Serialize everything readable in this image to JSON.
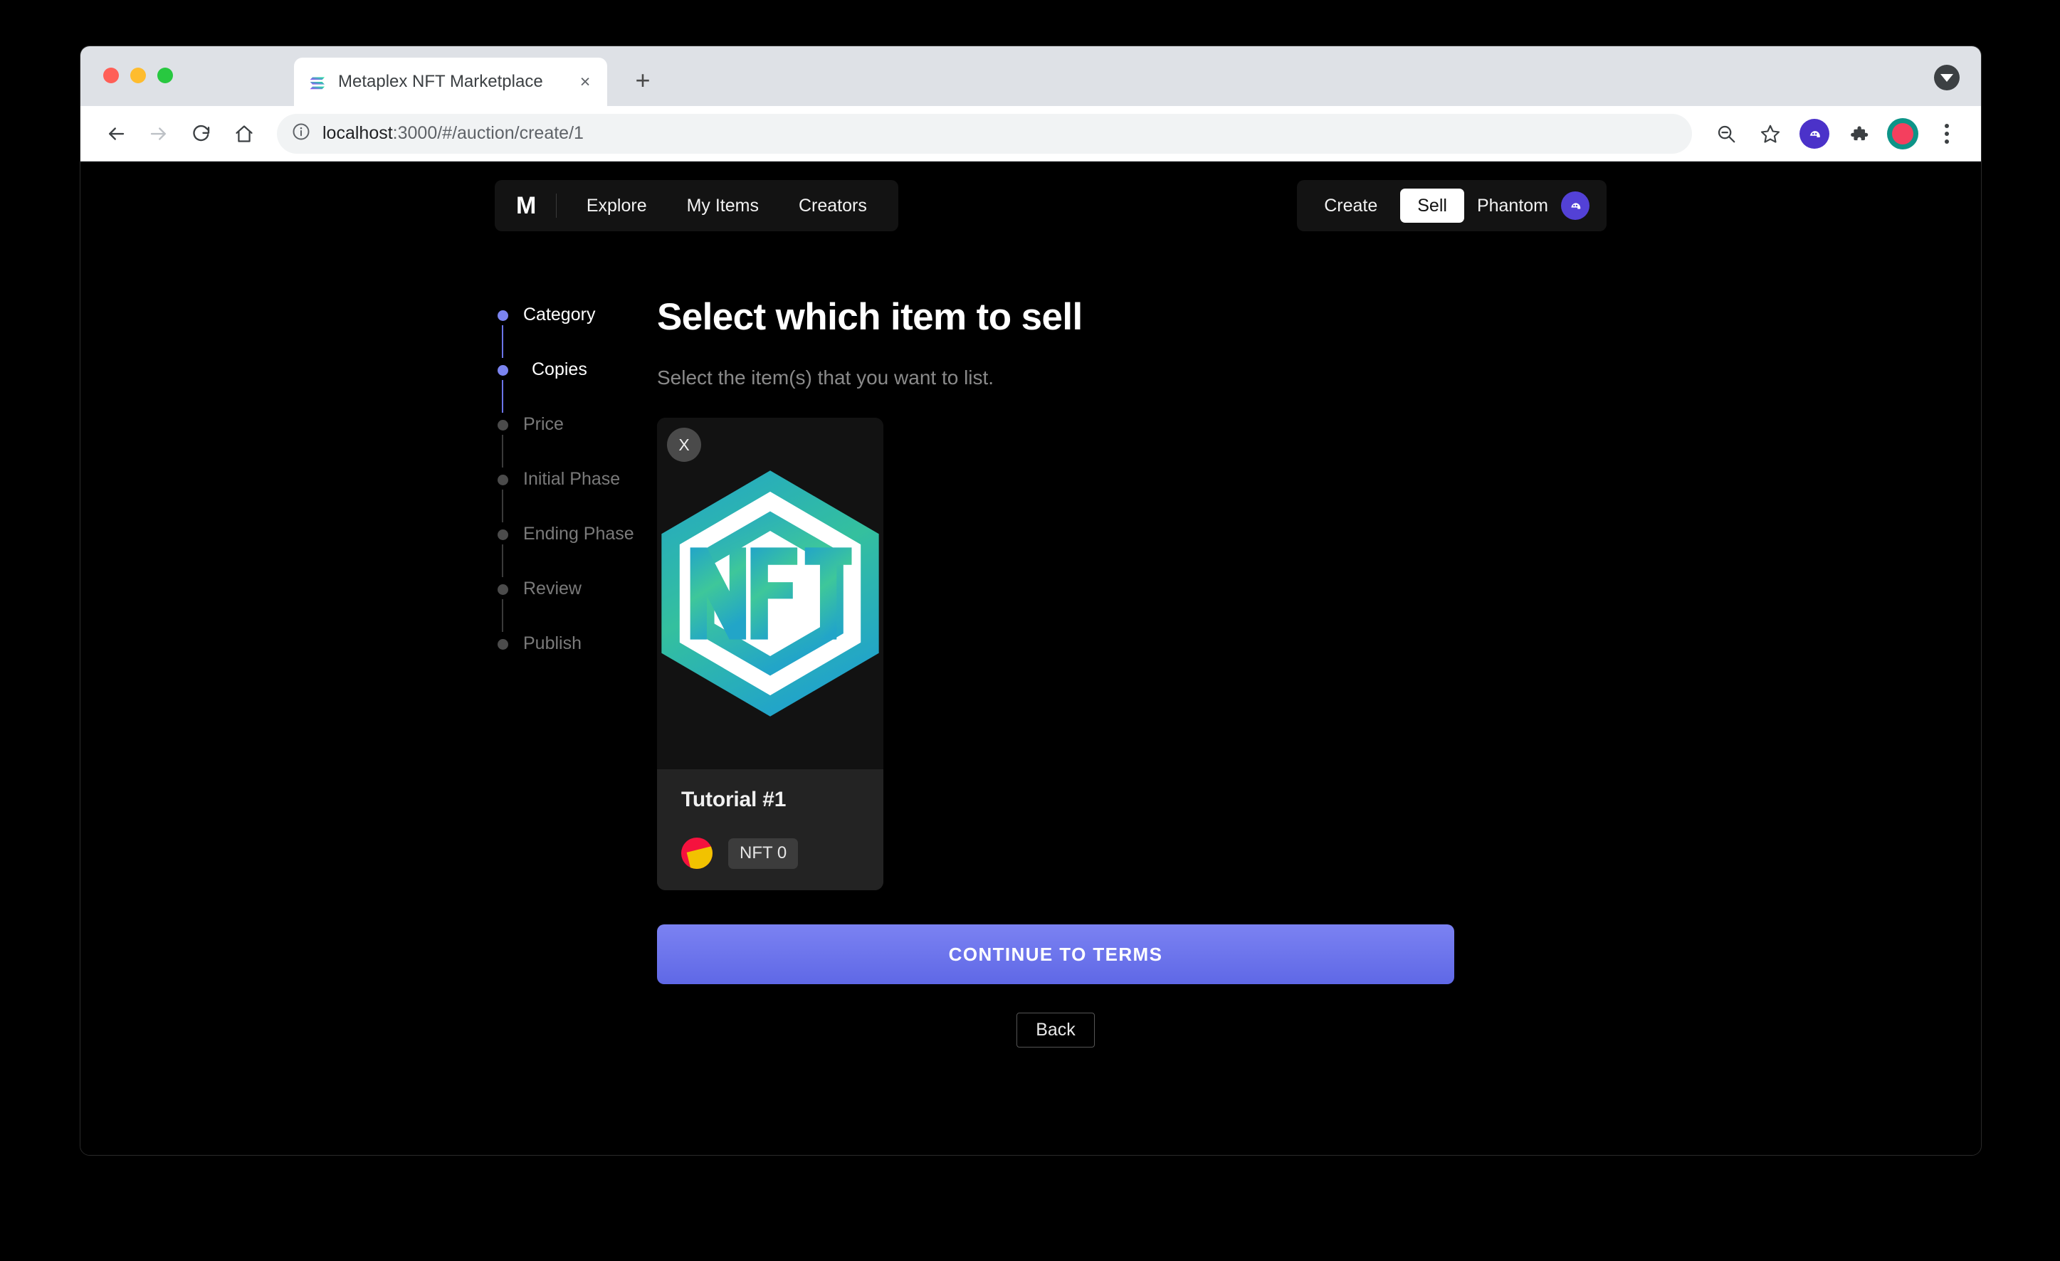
{
  "browser": {
    "tab": {
      "title": "Metaplex NFT Marketplace",
      "favicon": "solana-logo-icon",
      "close": "×"
    },
    "newtab_label": "+",
    "toolbar": {
      "back": "back-icon",
      "forward": "forward-icon",
      "reload": "reload-icon",
      "home": "home-icon",
      "site_info": "info-icon",
      "url_host": "localhost",
      "url_rest": ":3000/#/auction/create/1",
      "zoom_out": "zoom-out-icon",
      "bookmark": "star-icon",
      "extension_phantom": "phantom-extension-icon",
      "extensions": "puzzle-icon",
      "profile": "watermelon-avatar",
      "menu": "kebab-menu-icon"
    }
  },
  "appnav": {
    "brand": "M",
    "links": [
      {
        "label": "Explore"
      },
      {
        "label": "My Items"
      },
      {
        "label": "Creators"
      }
    ],
    "right": {
      "create_label": "Create",
      "sell_label": "Sell",
      "wallet_label": "Phantom",
      "wallet_icon": "phantom-ghost-icon"
    }
  },
  "steps": [
    {
      "label": "Category",
      "state": "active"
    },
    {
      "label": "Copies",
      "state": "active"
    },
    {
      "label": "Price",
      "state": "inactive"
    },
    {
      "label": "Initial Phase",
      "state": "inactive"
    },
    {
      "label": "Ending Phase",
      "state": "inactive"
    },
    {
      "label": "Review",
      "state": "inactive"
    },
    {
      "label": "Publish",
      "state": "inactive"
    }
  ],
  "main": {
    "heading": "Select which item to sell",
    "subheading": "Select the item(s) that you want to list.",
    "card": {
      "remove_label": "X",
      "image_alt": "nft-hexagon-logo",
      "title": "Tutorial #1",
      "creator_avatar": "creator-avatar",
      "badge": "NFT 0"
    },
    "cta_label": "CONTINUE TO TERMS",
    "back_label": "Back"
  },
  "colors": {
    "page_bg": "#000000",
    "accent": "#6b74e8",
    "card_bg": "#232323",
    "nft_teal": "#29a8c9",
    "nft_green": "#3ec79a",
    "phantom_purple": "#5341d6"
  }
}
